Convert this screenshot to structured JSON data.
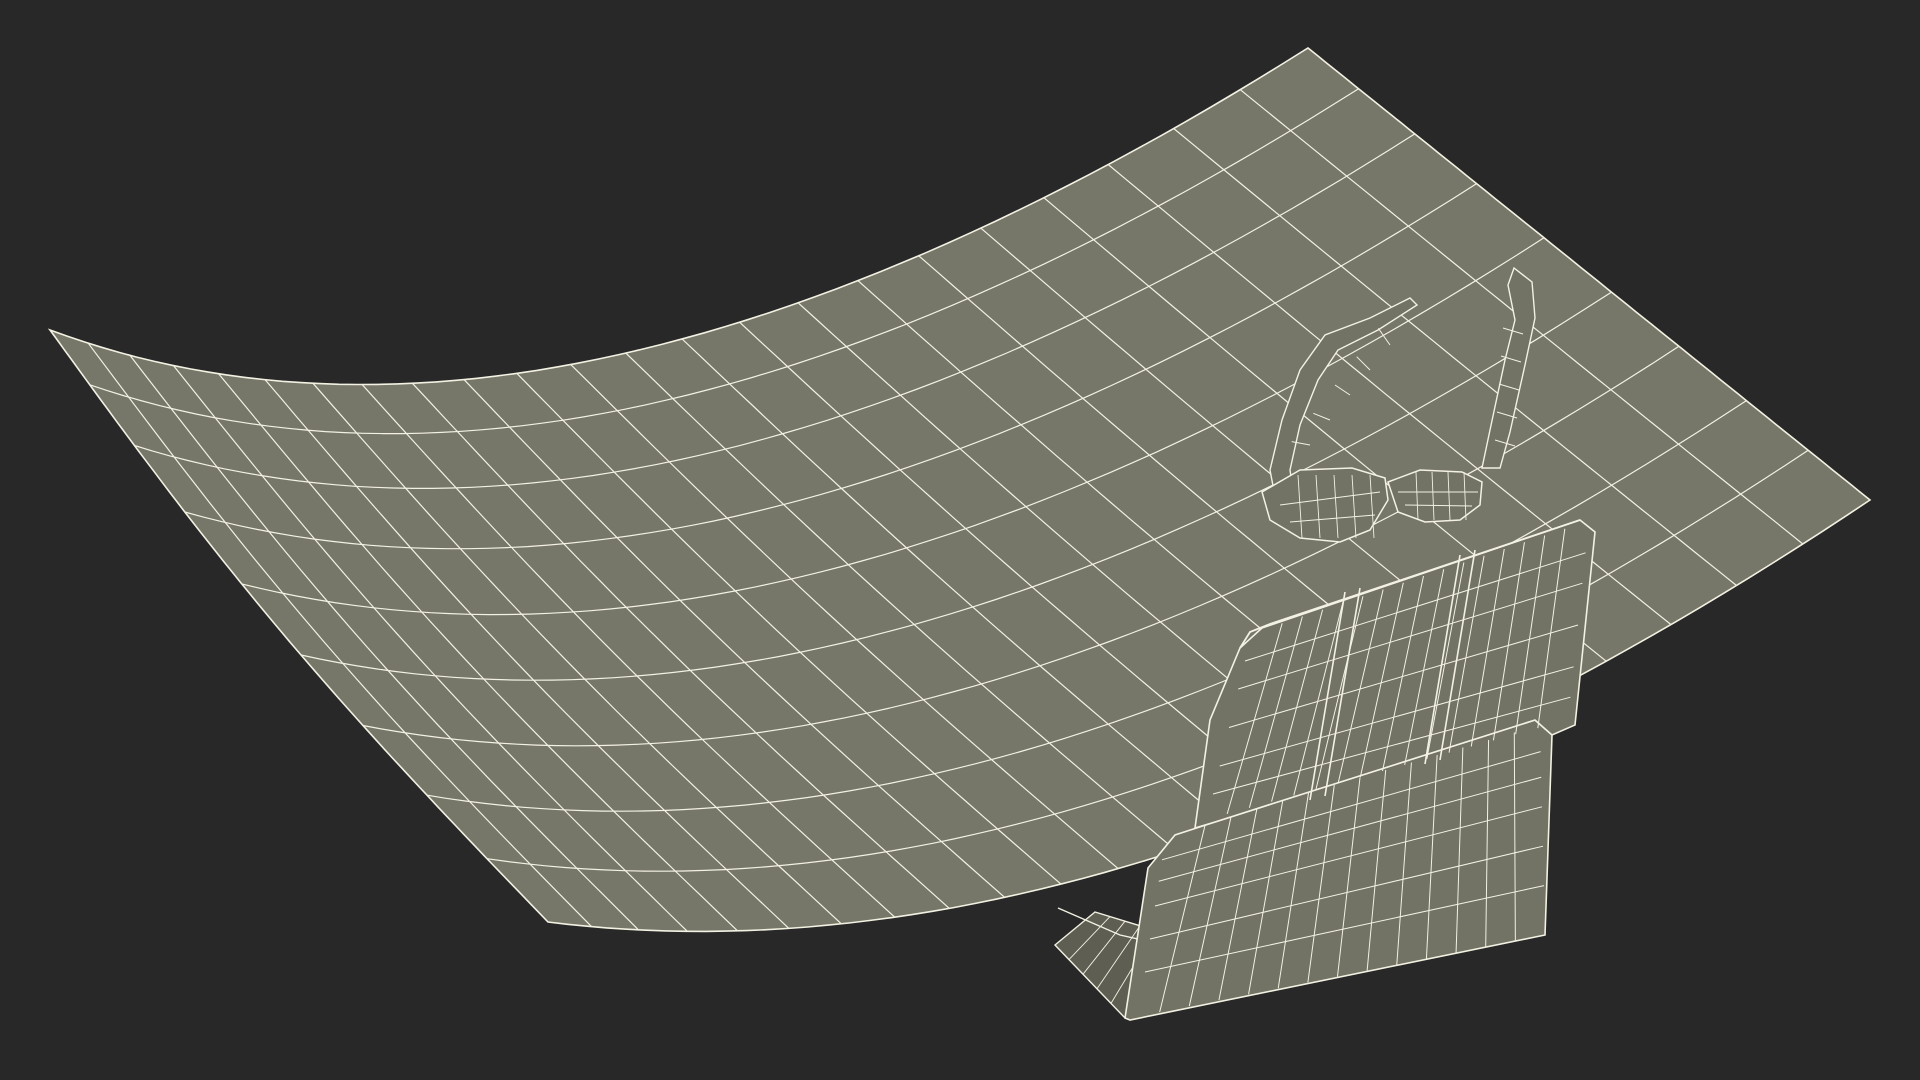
{
  "scene": {
    "background_color": "#282828",
    "surface_fill": "#767669",
    "seat_fill": "#727265",
    "wire_color": "#f3f1e2",
    "objects": [
      {
        "id": "curved-screen",
        "kind": "curved screen panel wireframe"
      },
      {
        "id": "vr-glasses",
        "kind": "glasses wireframe"
      },
      {
        "id": "seat",
        "kind": "seat backrest wireframe"
      }
    ]
  }
}
